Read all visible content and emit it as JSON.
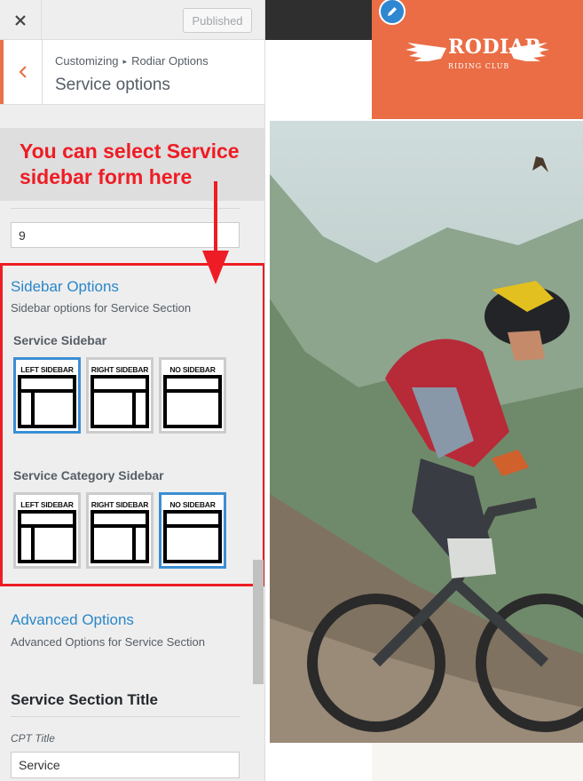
{
  "topbar": {
    "close_icon": "close-icon",
    "publish_label": "Published"
  },
  "header": {
    "back_icon": "chevron-left-icon",
    "breadcrumb_root": "Customizing",
    "breadcrumb_separator": "▸",
    "breadcrumb_parent": "Rodiar Options",
    "title": "Service options"
  },
  "annotation": {
    "text": "You can select Service sidebar form here",
    "color": "#ee1c24"
  },
  "number_field": {
    "value": "9"
  },
  "sidebar_options": {
    "title": "Sidebar Options",
    "description": "Sidebar options for Service Section",
    "service_sidebar": {
      "label": "Service Sidebar",
      "options": [
        {
          "label": "LEFT SIDEBAR",
          "layout": "left",
          "selected": true
        },
        {
          "label": "RIGHT SIDEBAR",
          "layout": "right",
          "selected": false
        },
        {
          "label": "NO SIDEBAR",
          "layout": "none",
          "selected": false
        }
      ]
    },
    "category_sidebar": {
      "label": "Service Category Sidebar",
      "options": [
        {
          "label": "LEFT SIDEBAR",
          "layout": "left",
          "selected": false
        },
        {
          "label": "RIGHT SIDEBAR",
          "layout": "right",
          "selected": false
        },
        {
          "label": "NO SIDEBAR",
          "layout": "none",
          "selected": true
        }
      ]
    }
  },
  "advanced_options": {
    "title": "Advanced Options",
    "description": "Advanced Options for Service Section"
  },
  "section_title": {
    "heading": "Service Section Title",
    "field_label": "CPT Title",
    "field_value": "Service"
  },
  "preview": {
    "logo_title": "RODIAR",
    "logo_subtitle": "RIDING CLUB",
    "brand_color": "#ea6d45",
    "edit_icon": "pencil-icon",
    "image": "mountain-biker-photo"
  },
  "colors": {
    "accent_blue": "#2a87c8",
    "selected_border": "#3b8fd3"
  }
}
